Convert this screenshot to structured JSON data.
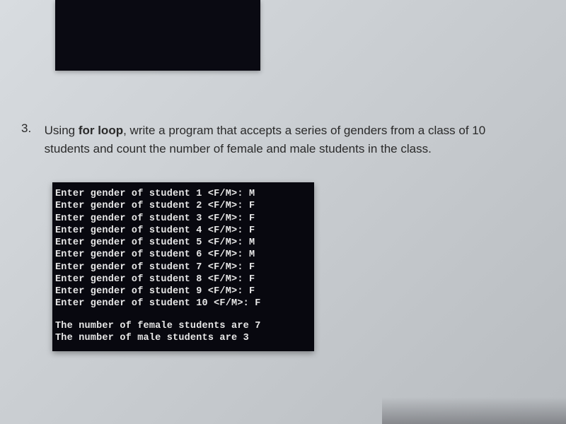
{
  "question": {
    "number": "3.",
    "text_part1": "Using ",
    "bold_phrase": "for loop",
    "text_part2": ", write a program that accepts a series of genders from a class of 10 students and count the number of female and male students in the class."
  },
  "console": {
    "lines": [
      "Enter gender of student 1 <F/M>: M",
      "Enter gender of student 2 <F/M>: F",
      "Enter gender of student 3 <F/M>: F",
      "Enter gender of student 4 <F/M>: F",
      "Enter gender of student 5 <F/M>: M",
      "Enter gender of student 6 <F/M>: M",
      "Enter gender of student 7 <F/M>: F",
      "Enter gender of student 8 <F/M>: F",
      "Enter gender of student 9 <F/M>: F",
      "Enter gender of student 10 <F/M>: F"
    ],
    "result1": "The number of female students are 7",
    "result2": "The number of male students are 3"
  }
}
